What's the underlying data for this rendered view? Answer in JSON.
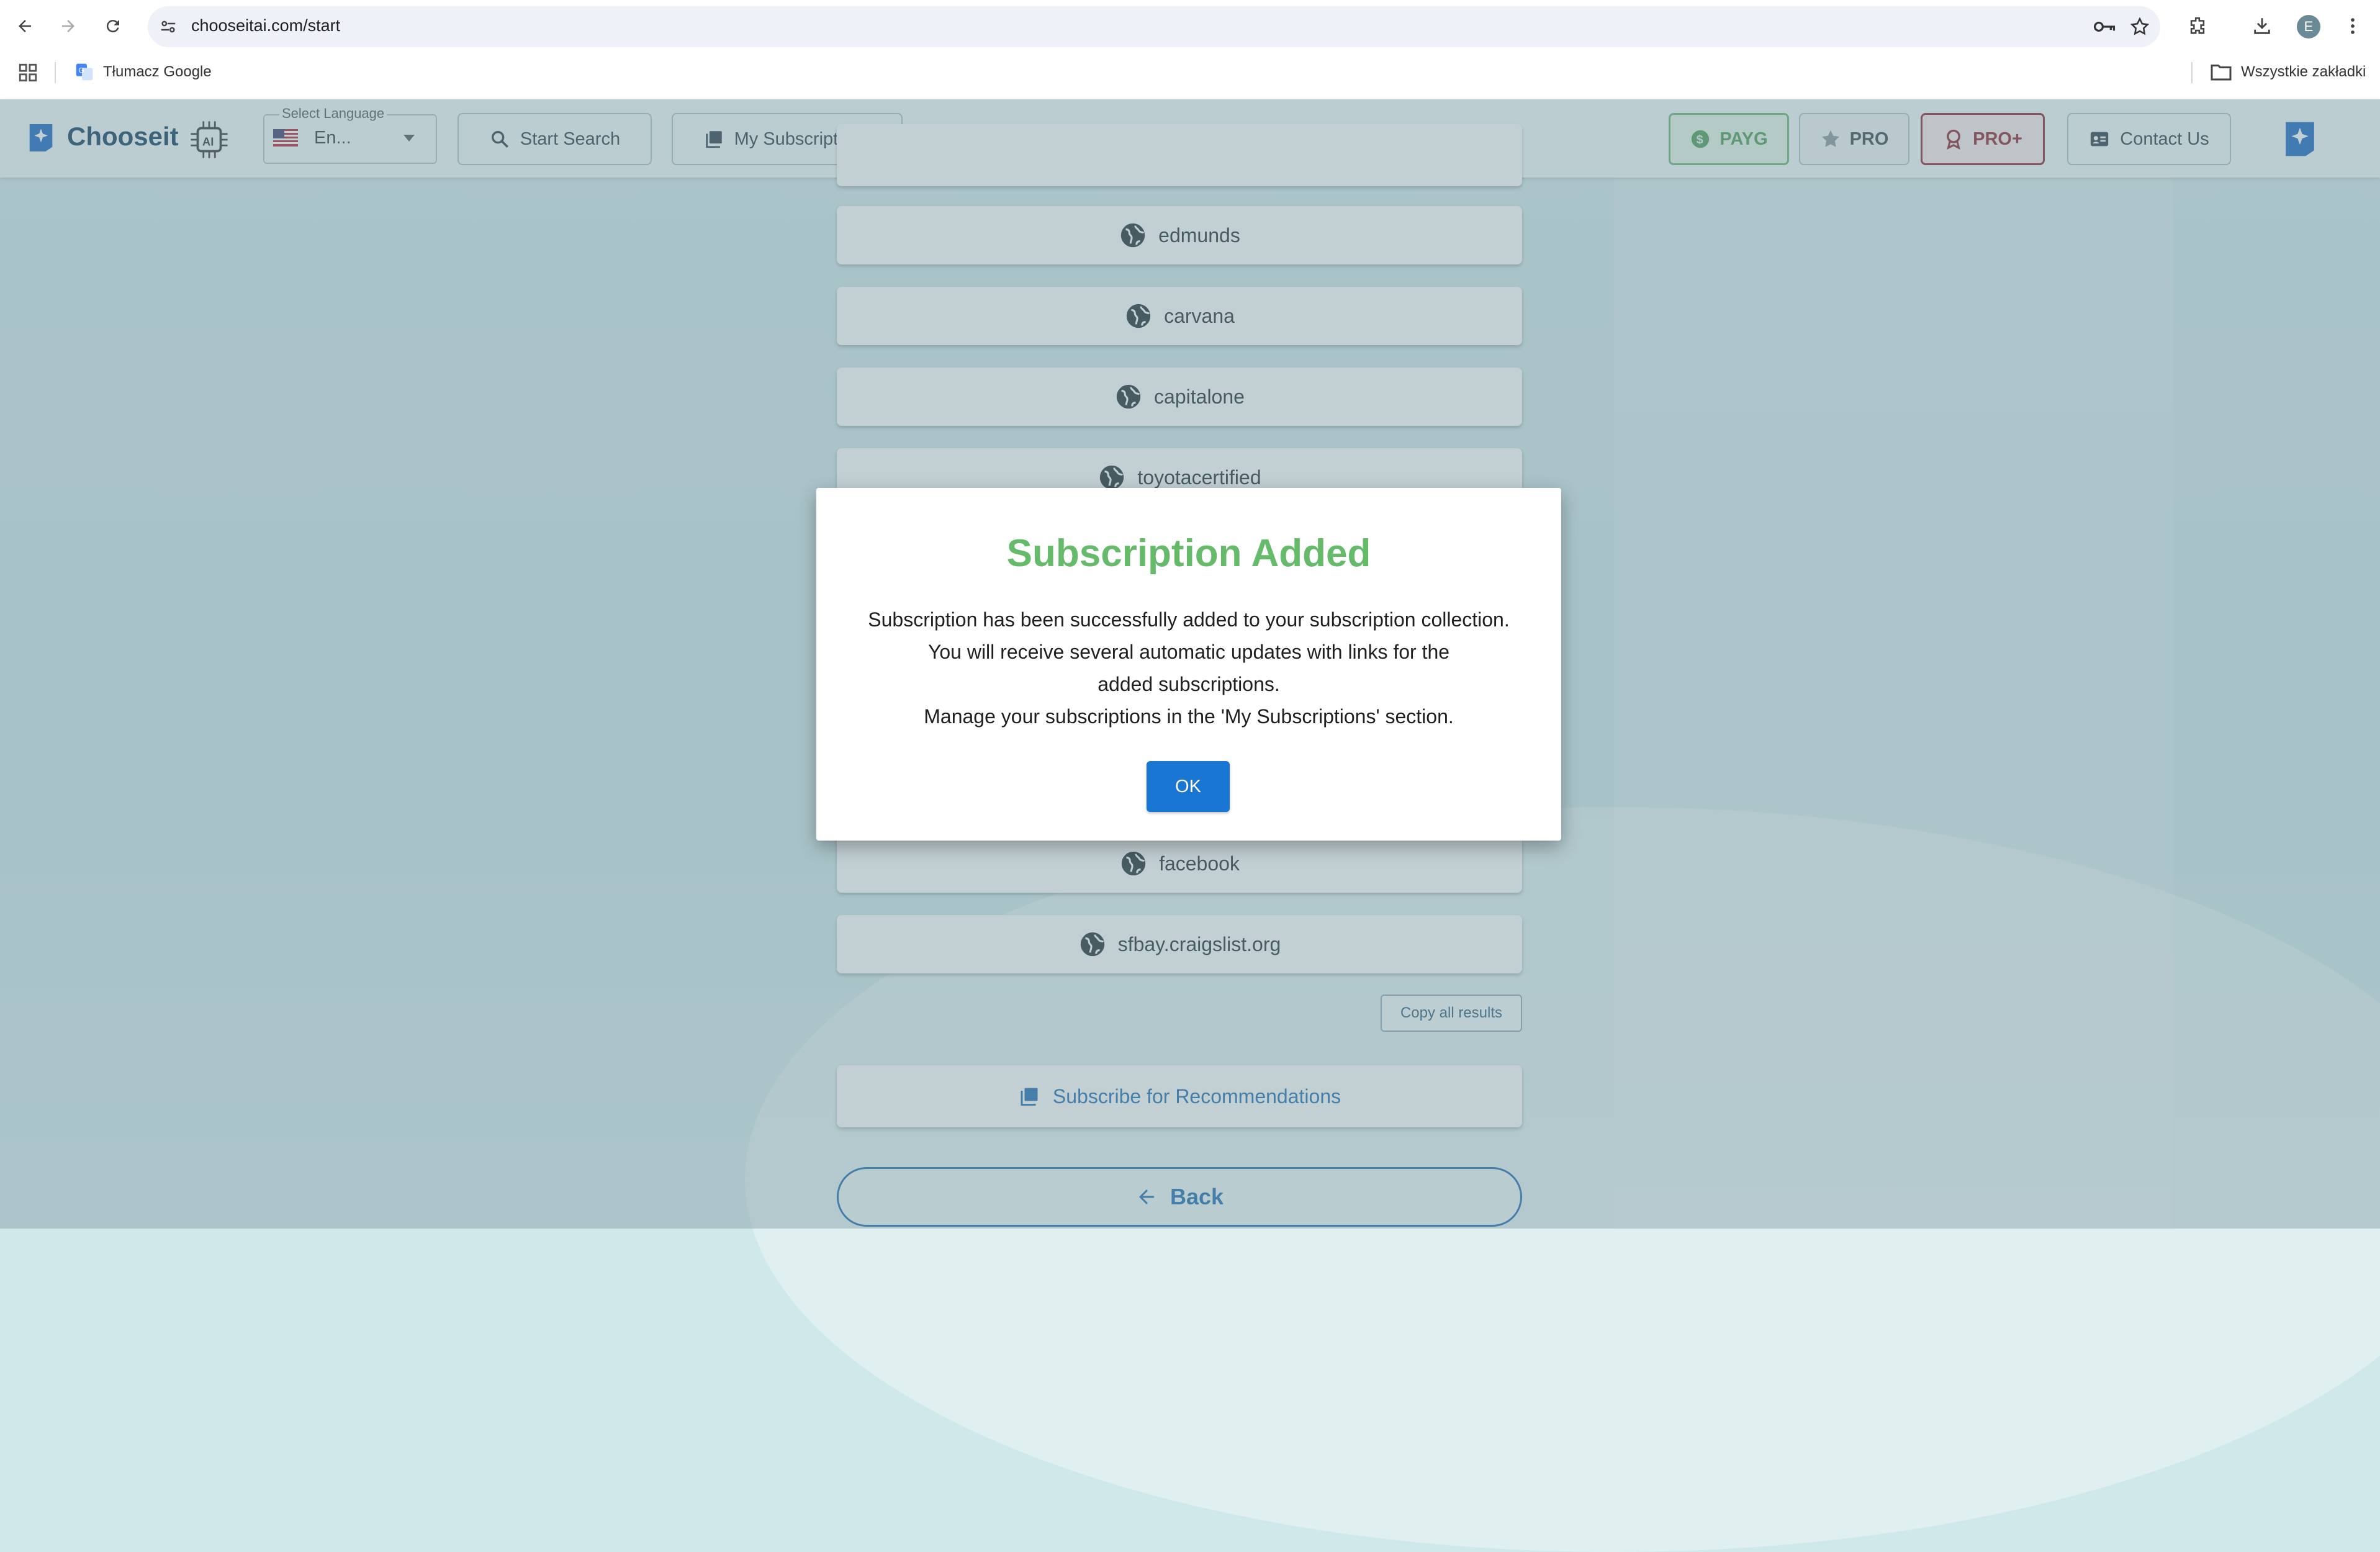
{
  "browser": {
    "url": "chooseitai.com/start",
    "profile_initial": "E",
    "bookmarks": {
      "translate_label": "Tłumacz Google",
      "all_bookmarks_label": "Wszystkie zakładki"
    }
  },
  "header": {
    "brand": "Chooseit",
    "language": {
      "label": "Select Language",
      "value": "En..."
    },
    "start_search": "Start Search",
    "my_subscriptions": "My Subscriptions",
    "plans": {
      "payg": "PAYG",
      "pro": "PRO",
      "pro_plus": "PRO+"
    },
    "contact": "Contact Us"
  },
  "results": [
    {
      "label": "edmunds"
    },
    {
      "label": "carvana"
    },
    {
      "label": "capitalone"
    },
    {
      "label": "toyotacertified"
    },
    {
      "label": "facebook"
    },
    {
      "label": "sfbay.craigslist.org"
    }
  ],
  "actions": {
    "copy_all": "Copy all results",
    "subscribe": "Subscribe for Recommendations",
    "back": "Back"
  },
  "modal": {
    "title": "Subscription Added",
    "line1": "Subscription has been successfully added to your subscription collection.",
    "line2": "You will receive several automatic updates with links for the added subscriptions.",
    "line3": "Manage your subscriptions in the 'My Subscriptions' section.",
    "ok": "OK"
  },
  "colors": {
    "modal_title": "#66bb6a",
    "ok_button": "#1976d2",
    "brand": "#0d3b5e",
    "payg": "#4a9a50",
    "pro_plus": "#8a1f2a",
    "link_blue": "#1c6bb0"
  }
}
